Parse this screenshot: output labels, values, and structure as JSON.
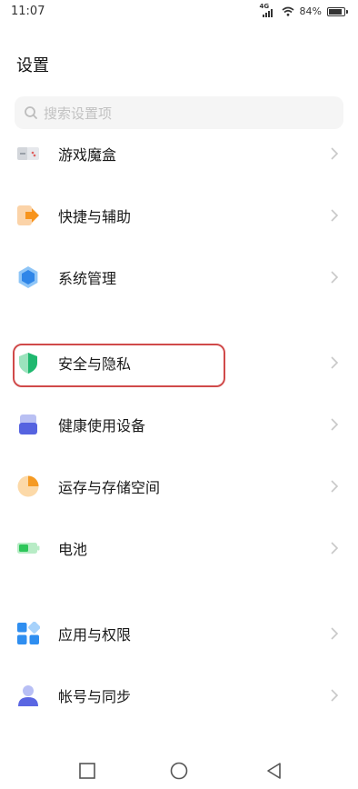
{
  "status": {
    "time": "11:07",
    "network": "4G",
    "battery_percent": "84%",
    "battery_level": 0.84
  },
  "header": {
    "title": "设置"
  },
  "search": {
    "placeholder": "搜索设置项",
    "icon": "search-icon"
  },
  "items": [
    {
      "label": "游戏魔盒",
      "icon": "game-box-icon"
    },
    {
      "label": "快捷与辅助",
      "icon": "shortcut-assist-icon"
    },
    {
      "label": "系统管理",
      "icon": "system-management-icon"
    },
    {
      "label": "安全与隐私",
      "icon": "shield-icon",
      "highlighted": true
    },
    {
      "label": "健康使用设备",
      "icon": "health-usage-icon"
    },
    {
      "label": "运存与存储空间",
      "icon": "storage-pie-icon"
    },
    {
      "label": "电池",
      "icon": "battery-icon"
    },
    {
      "label": "应用与权限",
      "icon": "apps-grid-icon"
    },
    {
      "label": "帐号与同步",
      "icon": "account-icon"
    }
  ],
  "nav": [
    "recents-button",
    "home-button",
    "back-button"
  ],
  "colors": {
    "highlight_border": "#d04a4a",
    "search_bg": "#f5f5f5"
  }
}
